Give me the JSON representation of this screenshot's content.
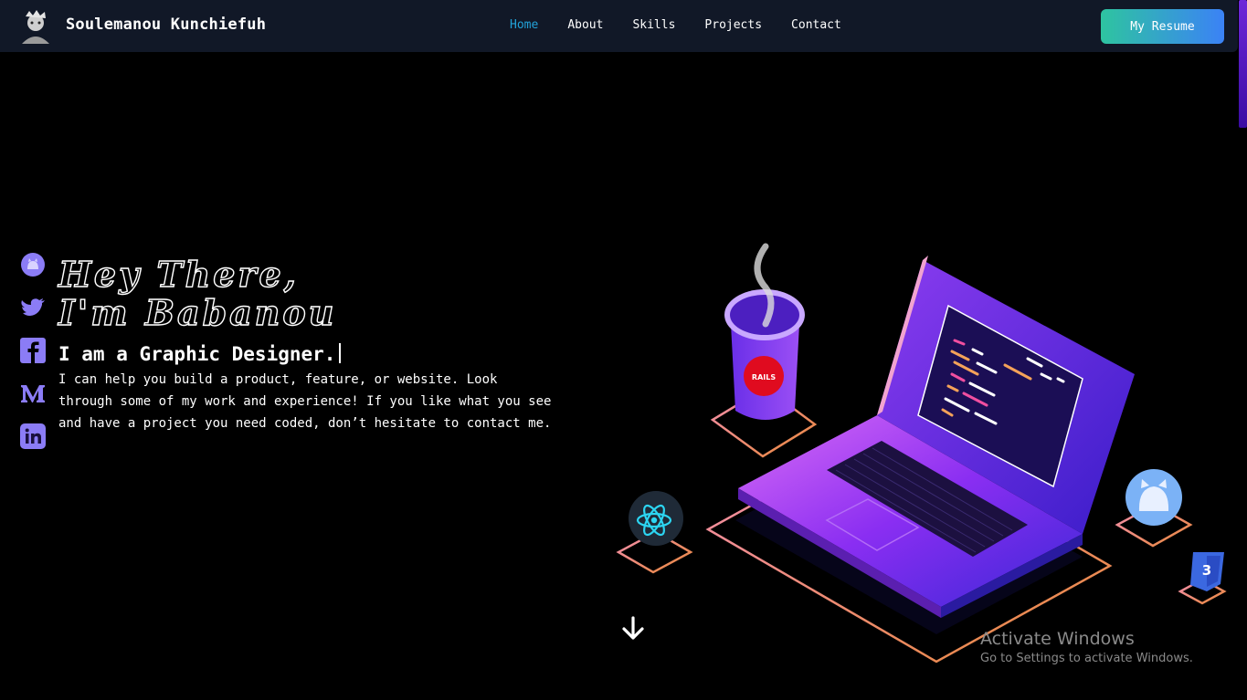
{
  "header": {
    "brand": "Soulemanou Kunchiefuh",
    "nav": [
      {
        "label": "Home",
        "active": true
      },
      {
        "label": "About"
      },
      {
        "label": "Skills"
      },
      {
        "label": "Projects"
      },
      {
        "label": "Contact"
      }
    ],
    "resume_button": "My Resume"
  },
  "socials": [
    {
      "icon": "github-icon"
    },
    {
      "icon": "twitter-icon"
    },
    {
      "icon": "facebook-icon"
    },
    {
      "icon": "medium-icon"
    },
    {
      "icon": "linkedin-icon"
    }
  ],
  "hero": {
    "line1": "Hey There,",
    "line2": "I'm Babanou",
    "role": "I am a Graphic Designer.",
    "intro": "I can help you build a product, feature, or website. Look through some of my work and experience! If you like what you see and have a project you need coded, don’t hesitate to contact me."
  },
  "illustration": {
    "cup_label": "RAILS"
  },
  "watermark": {
    "title": "Activate Windows",
    "subtitle": "Go to Settings to activate Windows."
  },
  "colors": {
    "nav_bg": "#111827",
    "active_link": "#22a2d8",
    "accent_purple": "#7c3aed",
    "button_gradient_start": "#2ec4a0",
    "button_gradient_end": "#3b82f6"
  }
}
